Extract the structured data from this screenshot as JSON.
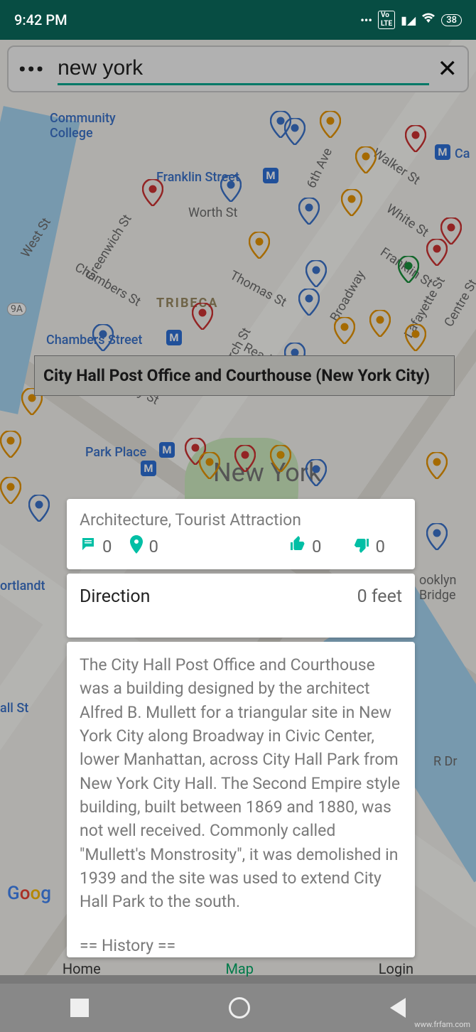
{
  "status": {
    "time": "9:42 PM",
    "volte": "Vo\nLTE",
    "battery": "38"
  },
  "search": {
    "value": "new york"
  },
  "tooltip": {
    "title": "City Hall Post Office and Courthouse (New York City)"
  },
  "map_labels": {
    "community": "Community\nCollege",
    "franklin": "Franklin Street",
    "tribeca": "TRIBECA",
    "chambers": "Chambers Street",
    "worth": "Worth St",
    "greenwich": "Greenwich St",
    "west": "West St",
    "chambers_st": "Chambers St",
    "thomas": "Thomas St",
    "reade": "Reade St",
    "murray": "Murray St",
    "church": "Church St",
    "broadway": "Broadway",
    "walker": "Walker St",
    "white": "White St",
    "franklin_st": "Franklin St",
    "lafayette": "Lafayette St",
    "centre": "Centre St",
    "sixth": "6th Ave",
    "park_place": "Park Place",
    "newyork": "New York",
    "cortlandt": "ortlandt",
    "hallst": "all St",
    "rdr": "R Dr",
    "brooklyn": "ooklyn\nBridge",
    "ca": "Ca",
    "metro": "M",
    "route": "9A"
  },
  "card": {
    "categories": "Architecture, Tourist Attraction",
    "comments": "0",
    "places": "0",
    "likes": "0",
    "dislikes": "0",
    "direction_label": "Direction",
    "distance": "0 feet",
    "description": "The City Hall Post Office and Courthouse was a building designed by the architect Alfred B. Mullett for a triangular site in New York City along Broadway in Civic Center, lower Manhattan, across City Hall Park from New York City Hall. The Second Empire style building, built between 1869 and 1880, was not well received. Commonly called \"Mullett's Monstrosity\", it was demolished in 1939 and the site was used to extend City Hall Park to the south.",
    "history_header": "== History =="
  },
  "tabs": {
    "home": "Home",
    "map": "Map",
    "login": "Login"
  },
  "watermark": "www.frfam.com"
}
